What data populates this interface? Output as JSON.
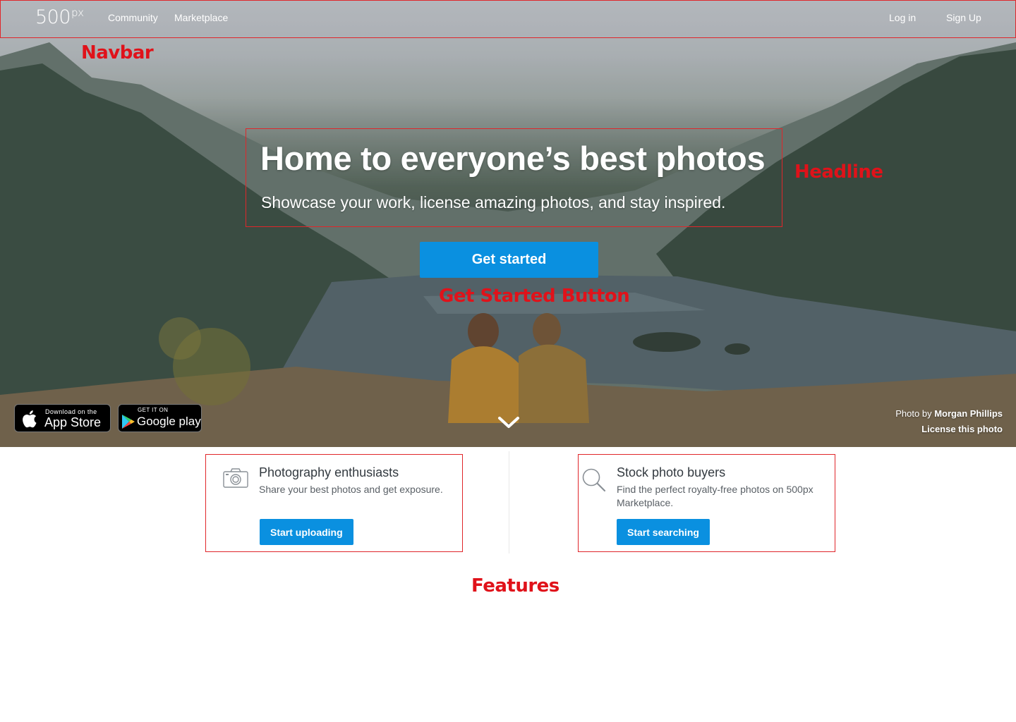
{
  "navbar": {
    "logo": "500",
    "logo_suffix": "px",
    "links": [
      "Community",
      "Marketplace"
    ],
    "login": "Log in",
    "signup": "Sign Up"
  },
  "annotations": {
    "navbar": "Navbar",
    "headline": "Headline",
    "get_started": "Get Started Button",
    "features": "Features"
  },
  "hero": {
    "headline": "Home to everyone’s best photos",
    "subheadline": "Showcase your work, license amazing photos, and stay inspired.",
    "cta": "Get started"
  },
  "badges": {
    "apple_small": "Download on the",
    "apple_big": "App Store",
    "google_small": "GET IT ON",
    "google_big": "Google play"
  },
  "credit": {
    "prefix": "Photo by",
    "author": "Morgan Phillips",
    "license": "License this photo"
  },
  "features": [
    {
      "icon": "camera-icon",
      "title": "Photography enthusiasts",
      "description": "Share your best photos and get exposure.",
      "button": "Start uploading"
    },
    {
      "icon": "search-icon",
      "title": "Stock photo buyers",
      "description": "Find the perfect royalty-free photos on 500px Marketplace.",
      "button": "Start searching"
    }
  ],
  "colors": {
    "primary_button": "#0a90e0",
    "annotation": "#e0121a"
  }
}
